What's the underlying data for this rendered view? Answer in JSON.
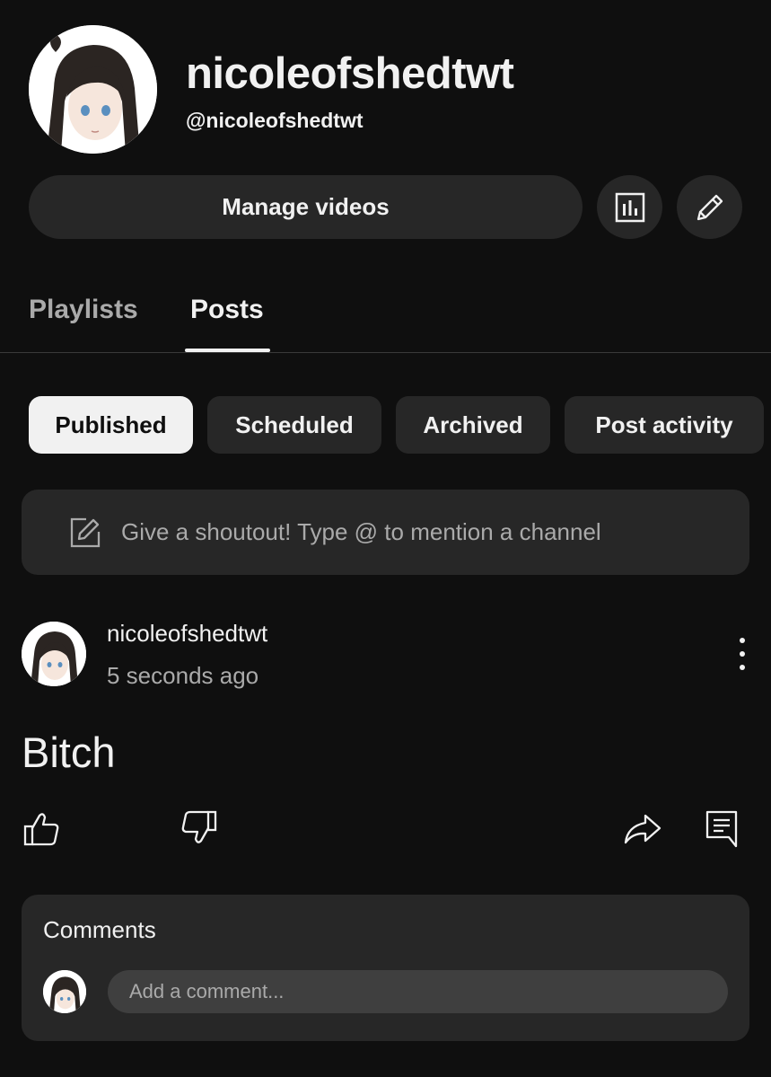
{
  "channel": {
    "name": "nicoleofshedtwt",
    "handle": "@nicoleofshedtwt"
  },
  "actions": {
    "manage_videos_label": "Manage videos",
    "analytics_icon": "analytics-icon",
    "edit_icon": "pencil-icon"
  },
  "tabs": [
    {
      "label": "Playlists",
      "active": false
    },
    {
      "label": "Posts",
      "active": true
    }
  ],
  "filters": [
    {
      "label": "Published",
      "active": true
    },
    {
      "label": "Scheduled",
      "active": false
    },
    {
      "label": "Archived",
      "active": false
    },
    {
      "label": "Post activity",
      "active": false
    }
  ],
  "shoutout": {
    "placeholder": "Give a shoutout! Type @ to mention a channel",
    "icon": "edit-square-icon"
  },
  "post": {
    "author": "nicoleofshedtwt",
    "time": "5 seconds ago",
    "body": "Bitch",
    "icons": [
      "thumbs-up-icon",
      "thumbs-down-icon",
      "share-icon",
      "comment-icon",
      "more-vert-icon"
    ]
  },
  "comments": {
    "title": "Comments",
    "input_placeholder": "Add a comment..."
  },
  "colors": {
    "background": "#0f0f0f",
    "surface": "#272727",
    "text_primary": "#f1f1f1",
    "text_secondary": "#aaaaaa"
  }
}
